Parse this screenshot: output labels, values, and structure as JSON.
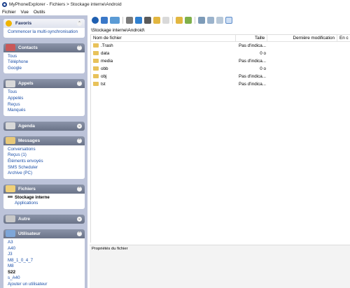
{
  "window": {
    "title": "MyPhoneExplorer  -  Fichiers > Stockage interne\\Android"
  },
  "menu": [
    "Fichier",
    "Vue",
    "Outils"
  ],
  "sidebar": {
    "favoris": {
      "title": "Favoris",
      "items": [
        "Commencer la multi-synchronisation"
      ]
    },
    "contacts": {
      "title": "Contacts",
      "items": [
        "Tous",
        "Téléphone",
        "Google"
      ]
    },
    "appels": {
      "title": "Appels",
      "items": [
        "Tous",
        "Appelés",
        "Reçus",
        "Manqués"
      ]
    },
    "agenda": {
      "title": "Agenda"
    },
    "messages": {
      "title": "Messages",
      "items": [
        "Conversations",
        "Reçus (1)",
        "Éléments envoyés",
        "SMS Scheduler",
        "Archive (PC)"
      ]
    },
    "fichiers": {
      "title": "Fichiers",
      "items": [
        "Stockage interne",
        "Applications"
      ]
    },
    "autre": {
      "title": "Autre"
    },
    "utilisateur": {
      "title": "Utilisateur",
      "items": [
        "A3",
        "A40",
        "J3",
        "M8_1_0_4_7",
        "M8",
        "S22",
        "s_A40",
        "Ajouter un utilisateur"
      ]
    }
  },
  "path": "\\Stockage interne\\Android\\",
  "filelist": {
    "columns": {
      "name": "Nom de fichier",
      "size": "Taille",
      "modified": "Dernière modification",
      "extra": "En c"
    },
    "rows": [
      {
        "name": ".Trash",
        "size": "Pas d'indica...",
        "modified": ""
      },
      {
        "name": "data",
        "size": "0 o",
        "modified": ""
      },
      {
        "name": "media",
        "size": "Pas d'indica...",
        "modified": ""
      },
      {
        "name": "obb",
        "size": "0 o",
        "modified": ""
      },
      {
        "name": "obj",
        "size": "Pas d'indica...",
        "modified": ""
      },
      {
        "name": "tst",
        "size": "Pas d'indica...",
        "modified": ""
      }
    ]
  },
  "properties": {
    "title": "Propriétés du fichier"
  },
  "colors": {
    "sidebar_bg": "#bcc3d9",
    "panel_head": "#6a7388",
    "link": "#1b4fa8",
    "folder": "#e8c25a"
  }
}
